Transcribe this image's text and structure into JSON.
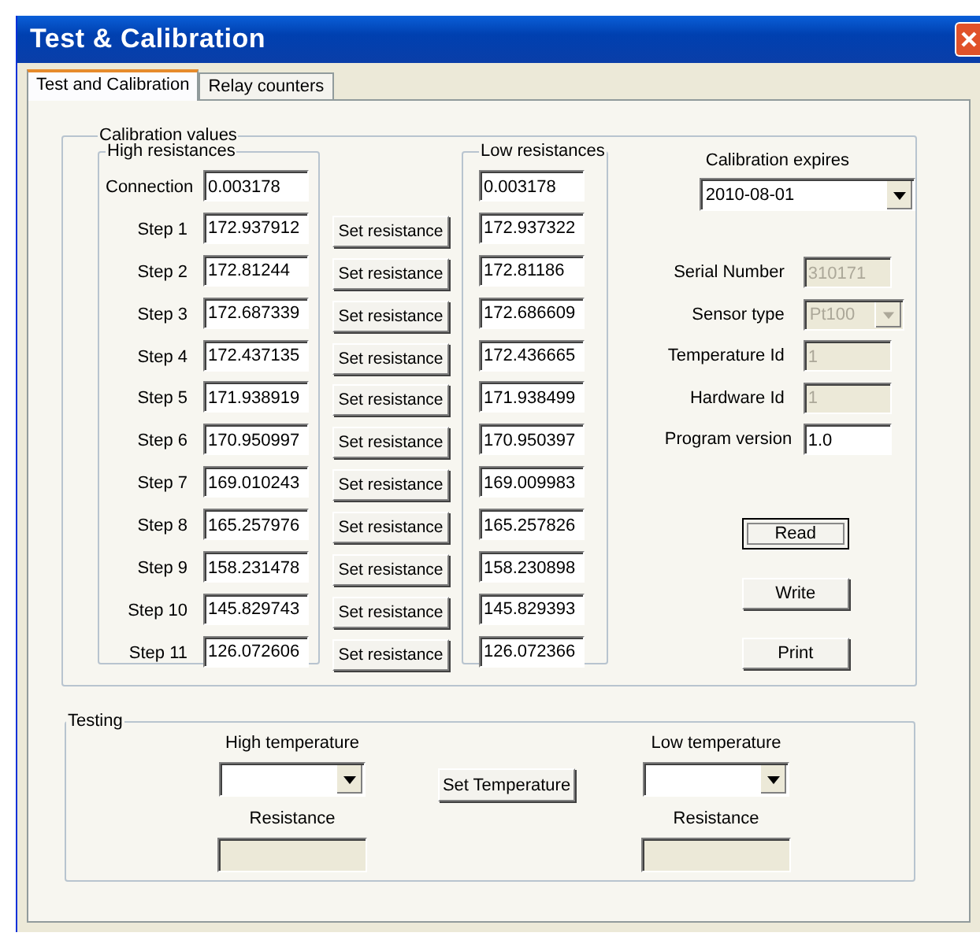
{
  "window": {
    "title": "Test & Calibration"
  },
  "tabs": [
    {
      "label": "Test and Calibration",
      "selected": true
    },
    {
      "label": "Relay counters",
      "selected": false
    }
  ],
  "calibration": {
    "title": "Calibration values",
    "high_title": "High resistances",
    "low_title": "Low resistances",
    "rows": [
      {
        "label": "Connection",
        "high": "0.003178",
        "low": "0.003178"
      },
      {
        "label": "Step 1",
        "high": "172.937912",
        "low": "172.937322",
        "button": "Set resistance"
      },
      {
        "label": "Step 2",
        "high": "172.81244",
        "low": "172.81186",
        "button": "Set resistance"
      },
      {
        "label": "Step 3",
        "high": "172.687339",
        "low": "172.686609",
        "button": "Set resistance"
      },
      {
        "label": "Step 4",
        "high": "172.437135",
        "low": "172.436665",
        "button": "Set resistance"
      },
      {
        "label": "Step 5",
        "high": "171.938919",
        "low": "171.938499",
        "button": "Set resistance"
      },
      {
        "label": "Step 6",
        "high": "170.950997",
        "low": "170.950397",
        "button": "Set resistance"
      },
      {
        "label": "Step 7",
        "high": "169.010243",
        "low": "169.009983",
        "button": "Set resistance"
      },
      {
        "label": "Step 8",
        "high": "165.257976",
        "low": "165.257826",
        "button": "Set resistance"
      },
      {
        "label": "Step 9",
        "high": "158.231478",
        "low": "158.230898",
        "button": "Set resistance"
      },
      {
        "label": "Step 10",
        "high": "145.829743",
        "low": "145.829393",
        "button": "Set resistance"
      },
      {
        "label": "Step 11",
        "high": "126.072606",
        "low": "126.072366",
        "button": "Set resistance"
      }
    ]
  },
  "expires": {
    "label": "Calibration expires",
    "value": "2010-08-01"
  },
  "info": [
    {
      "label": "Serial Number",
      "value": "310171",
      "disabled": true,
      "kind": "text"
    },
    {
      "label": "Sensor type",
      "value": "Pt100",
      "disabled": true,
      "kind": "dropdown"
    },
    {
      "label": "Temperature Id",
      "value": "1",
      "disabled": true,
      "kind": "text"
    },
    {
      "label": "Hardware Id",
      "value": "1",
      "disabled": true,
      "kind": "text"
    },
    {
      "label": "Program version",
      "value": "1.0",
      "disabled": false,
      "kind": "text"
    }
  ],
  "actions": [
    {
      "label": "Read",
      "focused": true
    },
    {
      "label": "Write",
      "focused": false
    },
    {
      "label": "Print",
      "focused": false
    }
  ],
  "testing": {
    "title": "Testing",
    "button": "Set Temperature",
    "sides": [
      {
        "label": "High temperature",
        "resistance_label": "Resistance"
      },
      {
        "label": "Low temperature",
        "resistance_label": "Resistance"
      }
    ]
  }
}
